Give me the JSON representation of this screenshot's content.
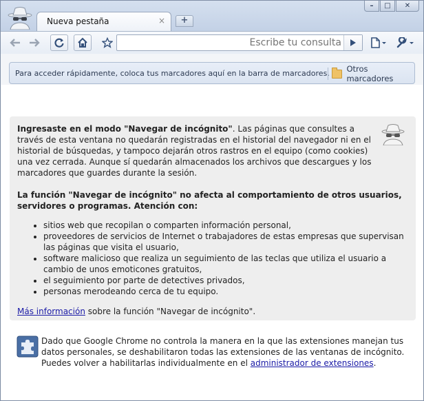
{
  "window": {
    "buttons": {
      "minimize": "–",
      "maximize": "□",
      "close": "✕"
    }
  },
  "tabs": [
    {
      "title": "Nueva pestaña",
      "close": "×"
    }
  ],
  "new_tab_label": "+",
  "toolbar": {
    "back_icon": "back-arrow-icon",
    "forward_icon": "forward-arrow-icon",
    "reload_icon": "reload-icon",
    "home_icon": "home-icon",
    "star_icon": "star-icon",
    "omnibox": {
      "value": "",
      "placeholder": "Escribe tu consulta"
    },
    "go_icon": "play-icon",
    "page_menu_icon": "page-menu-icon",
    "wrench_icon": "wrench-icon"
  },
  "bookmarks_bar": {
    "message": "Para acceder rápidamente, coloca tus marcadores aquí en la barra de marcadores.",
    "other_bookmarks": "Otros marcadores"
  },
  "incognito": {
    "p1_bold": "Ingresaste en el modo \"Navegar de incógnito\"",
    "p1_rest": ". Las páginas que consultes a través de esta ventana no quedarán registradas en el historial del navegador ni en el historial de búsquedas, y tampoco dejarán otros rastros en el equipo (como cookies) una vez cerrada. Aunque sí quedarán almacenados los archivos que descargues y los marcadores que guardes durante la sesión.",
    "p2": "La función \"Navegar de incógnito\" no afecta al comportamiento de otros usuarios, servidores o programas. Atención con:",
    "bullets": [
      "sitios web que recopilan o comparten información personal,",
      "proveedores de servicios de Internet o trabajadores de estas empresas que supervisan las páginas que visita el usuario,",
      "software malicioso que realiza un seguimiento de las teclas que utiliza el usuario a cambio de unos emoticones gratuitos,",
      "el seguimiento por parte de detectives privados,",
      "personas merodeando cerca de tu equipo."
    ],
    "more_link": "Más información",
    "more_rest": " sobre la función \"Navegar de incógnito\"."
  },
  "extensions": {
    "text": "Dado que Google Chrome no controla la manera en la que las extensiones manejan tus datos personales, se deshabilitaron todas las extensiones de las ventanas de incógnito. Puedes volver a habilitarlas individualmente en el ",
    "link": "administrador de extensiones",
    "end": "."
  },
  "colors": {
    "link": "#1a1aa6",
    "frame": "#c3d1e6",
    "box": "#eeeeee"
  }
}
